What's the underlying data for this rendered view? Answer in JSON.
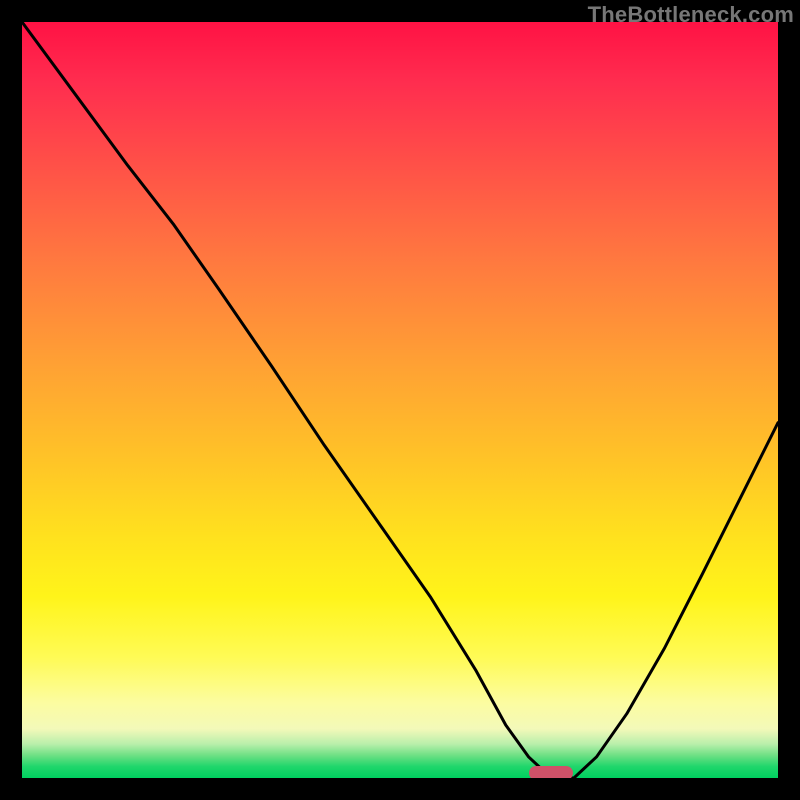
{
  "watermark": "TheBottleneck.com",
  "marker": {
    "x_frac": 0.7,
    "y_frac": 0.994,
    "color": "#cf5168"
  },
  "chart_data": {
    "type": "line",
    "title": "",
    "xlabel": "",
    "ylabel": "",
    "xlim": [
      0,
      1
    ],
    "ylim": [
      0,
      1
    ],
    "grid": false,
    "legend": false,
    "background_gradient": {
      "direction": "top_to_bottom",
      "stops": [
        {
          "pos": 0.0,
          "color": "#ff1244"
        },
        {
          "pos": 0.2,
          "color": "#ff5447"
        },
        {
          "pos": 0.45,
          "color": "#ffa034"
        },
        {
          "pos": 0.68,
          "color": "#ffe11e"
        },
        {
          "pos": 0.9,
          "color": "#fcfca0"
        },
        {
          "pos": 0.97,
          "color": "#6ee084"
        },
        {
          "pos": 1.0,
          "color": "#00d060"
        }
      ]
    },
    "marker_point": {
      "x": 0.7,
      "y": 0.0
    },
    "series": [
      {
        "name": "curve",
        "x": [
          0.0,
          0.07,
          0.14,
          0.2,
          0.26,
          0.33,
          0.4,
          0.47,
          0.54,
          0.6,
          0.64,
          0.67,
          0.7,
          0.73,
          0.76,
          0.8,
          0.85,
          0.9,
          0.95,
          1.0
        ],
        "y": [
          1.0,
          0.905,
          0.81,
          0.733,
          0.647,
          0.545,
          0.44,
          0.34,
          0.24,
          0.143,
          0.07,
          0.028,
          0.0,
          0.0,
          0.028,
          0.085,
          0.172,
          0.27,
          0.37,
          0.47
        ]
      }
    ]
  }
}
